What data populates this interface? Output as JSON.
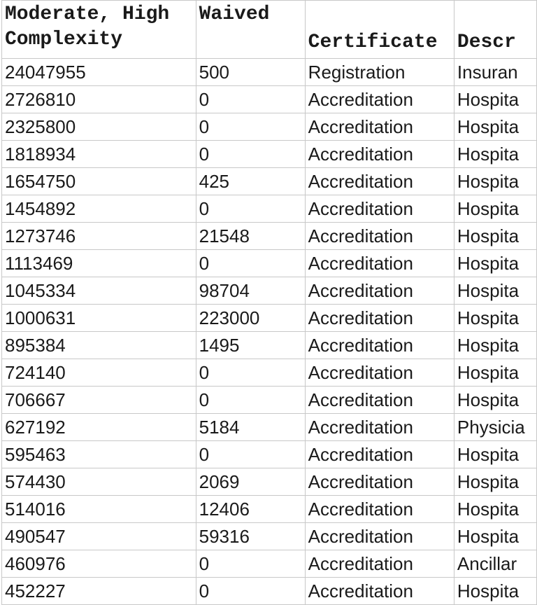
{
  "headers": [
    "Moderate, High Complexity",
    "Waived",
    "Certificate",
    "Descr"
  ],
  "rows": [
    [
      "24047955",
      "500",
      "Registration",
      "Insuran"
    ],
    [
      "2726810",
      "0",
      "Accreditation",
      "Hospita"
    ],
    [
      "2325800",
      "0",
      "Accreditation",
      "Hospita"
    ],
    [
      "1818934",
      "0",
      "Accreditation",
      "Hospita"
    ],
    [
      "1654750",
      "425",
      "Accreditation",
      "Hospita"
    ],
    [
      "1454892",
      "0",
      "Accreditation",
      "Hospita"
    ],
    [
      "1273746",
      "21548",
      "Accreditation",
      "Hospita"
    ],
    [
      "1113469",
      "0",
      "Accreditation",
      "Hospita"
    ],
    [
      "1045334",
      "98704",
      "Accreditation",
      "Hospita"
    ],
    [
      "1000631",
      "223000",
      "Accreditation",
      "Hospita"
    ],
    [
      "895384",
      "1495",
      "Accreditation",
      "Hospita"
    ],
    [
      "724140",
      "0",
      "Accreditation",
      "Hospita"
    ],
    [
      "706667",
      "0",
      "Accreditation",
      "Hospita"
    ],
    [
      "627192",
      "5184",
      "Accreditation",
      "Physicia"
    ],
    [
      "595463",
      "0",
      "Accreditation",
      "Hospita"
    ],
    [
      "574430",
      "2069",
      "Accreditation",
      "Hospita"
    ],
    [
      "514016",
      "12406",
      "Accreditation",
      "Hospita"
    ],
    [
      "490547",
      "59316",
      "Accreditation",
      "Hospita"
    ],
    [
      "460976",
      "0",
      "Accreditation",
      "Ancillar"
    ],
    [
      "452227",
      "0",
      "Accreditation",
      "Hospita"
    ]
  ]
}
